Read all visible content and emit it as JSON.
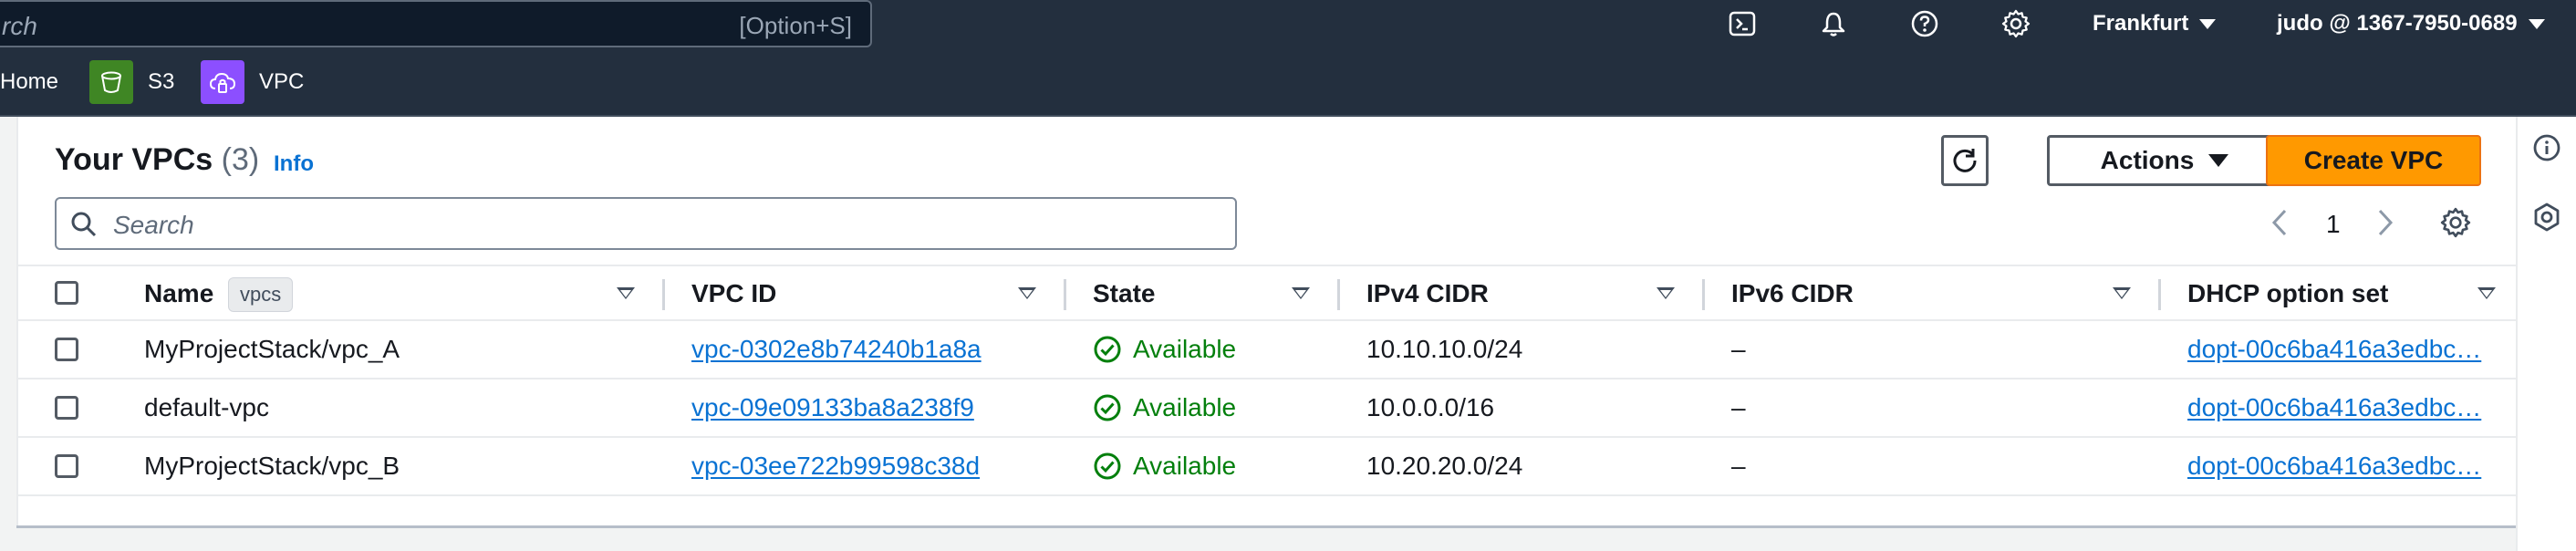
{
  "topbar": {
    "search_placeholder": "rch",
    "search_shortcut": "[Option+S]",
    "icons": [
      "cloudshell-icon",
      "bell-icon",
      "help-icon",
      "gear-icon"
    ],
    "region": "Frankfurt",
    "account": "judo @ 1367-7950-0689"
  },
  "favorites": [
    {
      "label": "Home",
      "icon": "home"
    },
    {
      "label": "S3",
      "icon": "s3-bucket-icon",
      "color": "#3f8624"
    },
    {
      "label": "VPC",
      "icon": "vpc-cloud-icon",
      "color": "#8c4fff"
    }
  ],
  "page": {
    "title": "Your VPCs",
    "count": "(3)",
    "info_link": "Info",
    "refresh_label": "refresh",
    "actions_label": "Actions",
    "create_label": "Create VPC",
    "search_placeholder": "Search",
    "page_number": "1"
  },
  "table": {
    "columns": [
      "Name",
      "VPC ID",
      "State",
      "IPv4 CIDR",
      "IPv6 CIDR",
      "DHCP option set"
    ],
    "name_tooltip": "vpcs",
    "rows": [
      {
        "name": "MyProjectStack/vpc_A",
        "vpc_id": "vpc-0302e8b74240b1a8a",
        "state": "Available",
        "ipv4": "10.10.10.0/24",
        "ipv6": "–",
        "dhcp": "dopt-00c6ba416a3edbc…"
      },
      {
        "name": "default-vpc",
        "vpc_id": "vpc-09e09133ba8a238f9",
        "state": "Available",
        "ipv4": "10.0.0.0/16",
        "ipv6": "–",
        "dhcp": "dopt-00c6ba416a3edbc…"
      },
      {
        "name": "MyProjectStack/vpc_B",
        "vpc_id": "vpc-03ee722b99598c38d",
        "state": "Available",
        "ipv4": "10.20.20.0/24",
        "ipv6": "–",
        "dhcp": "dopt-00c6ba416a3edbc…"
      }
    ]
  },
  "colors": {
    "nav_bg": "#232f3e",
    "primary": "#ff9900",
    "link": "#0972d3",
    "success": "#037f0c"
  }
}
